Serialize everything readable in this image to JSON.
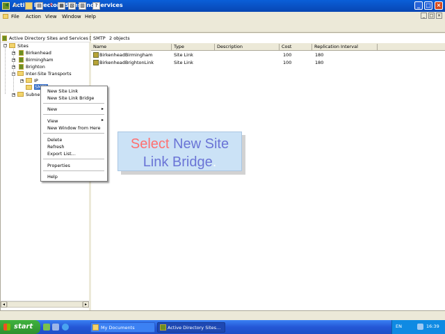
{
  "window": {
    "title": "Active Directory Sites and Services",
    "controls": {
      "minimize": "_",
      "maximize": "□",
      "close": "×"
    }
  },
  "menu": [
    "File",
    "Action",
    "View",
    "Window",
    "Help"
  ],
  "toolbar": [
    "back-icon",
    "forward-icon",
    "up-folder-icon",
    "show-tree-icon",
    "delete-icon",
    "properties-icon",
    "refresh-icon",
    "export-icon",
    "help-icon"
  ],
  "left_pane": {
    "header": "Active Directory Sites and Services [a",
    "tree": {
      "sites": "Sites",
      "birkenhead": "Birkenhead",
      "birmingham": "Birmingham",
      "brighton": "Brighton",
      "inter_site": "Inter-Site Transports",
      "ip": "IP",
      "smtp": "SMTP",
      "subnets": "Subne"
    }
  },
  "right_pane": {
    "container": "SMTP",
    "count": "2 objects",
    "columns": [
      "Name",
      "Type",
      "Description",
      "Cost",
      "Replication Interval"
    ],
    "rows": [
      {
        "name": "BirkenheadBirmingham",
        "type": "Site Link",
        "description": "",
        "cost": "100",
        "interval": "180"
      },
      {
        "name": "BirkenheadBrightonLink",
        "type": "Site Link",
        "description": "",
        "cost": "100",
        "interval": "180"
      }
    ]
  },
  "context_menu": {
    "new_site_link": "New Site Link",
    "new_site_link_bridge": "New Site Link Bridge",
    "new": "New",
    "view": "View",
    "new_window": "New Window from Here",
    "delete": "Delete",
    "refresh": "Refresh",
    "export": "Export List...",
    "properties": "Properties",
    "help": "Help",
    "submenu_arrow": "▸"
  },
  "hint": {
    "w1": "Select",
    "w2": "New",
    "w3": "Site",
    "line2a": "Link Bridge",
    "w4": "."
  },
  "taskbar": {
    "start": "start",
    "tasks": [
      "My Documents",
      "Active Directory Sites..."
    ],
    "lang": "EN",
    "clock": "16:39"
  },
  "colors": {
    "titlebar": "#0a5fd8",
    "hint_bg": "#cbe2f6",
    "hint_red": "#ff7070",
    "hint_blue": "#6a74d6",
    "taskbar": "#2457d6",
    "start": "#3fb33f"
  }
}
